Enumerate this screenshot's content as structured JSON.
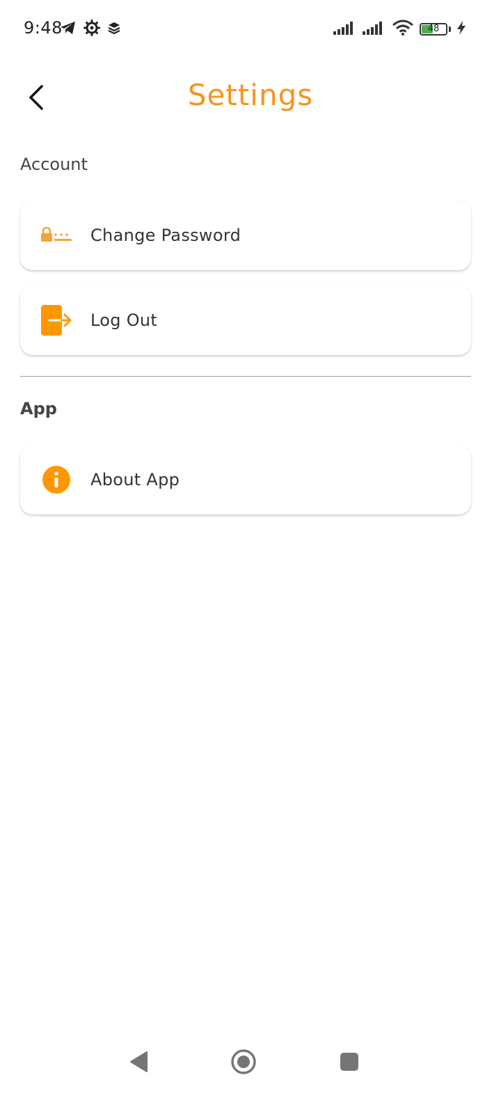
{
  "status_bar": {
    "time": "9:48",
    "battery_level": "48",
    "battery_fraction": 0.48,
    "icons": [
      "telegram-icon",
      "settings-gear-icon",
      "layers-icon",
      "signal-icon",
      "signal-icon",
      "wifi-icon",
      "battery-icon",
      "charging-icon"
    ]
  },
  "header": {
    "title": "Settings",
    "back_icon": "chevron-left-icon"
  },
  "sections": {
    "account": {
      "label": "Account",
      "items": [
        {
          "label": "Change Password",
          "icon": "password-lock-icon"
        },
        {
          "label": "Log Out",
          "icon": "logout-icon"
        }
      ]
    },
    "app": {
      "label": "App",
      "items": [
        {
          "label": "About App",
          "icon": "info-icon"
        }
      ]
    }
  },
  "colors": {
    "accent": "#F7931E",
    "icon": "#FF9800",
    "text": "#333333",
    "divider": "#9E9E9E",
    "battery": "#4CAF50"
  },
  "nav_bar": {
    "icons": [
      "nav-back-icon",
      "nav-home-icon",
      "nav-recents-icon"
    ]
  }
}
